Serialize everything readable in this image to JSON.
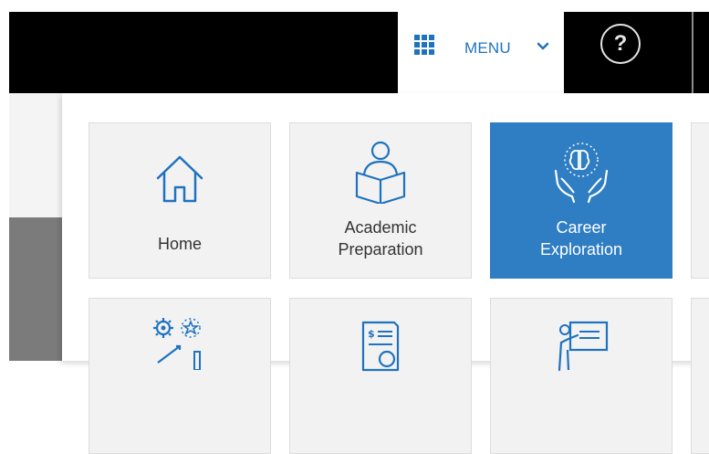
{
  "header": {
    "menu_label": "MENU",
    "help_label": "?",
    "icons": {
      "menu": "grid-icon",
      "chevron": "chevron-down-icon",
      "help": "question-circle-icon"
    }
  },
  "menu_tiles": [
    {
      "label": "Home",
      "icon": "house-icon",
      "active": false
    },
    {
      "label": "Academic\nPreparation",
      "icon": "reading-person-icon",
      "active": false
    },
    {
      "label": "Career\nExploration",
      "icon": "brain-hands-icon",
      "active": true
    },
    {
      "label": "",
      "icon": "gears-growth-icon",
      "active": false
    },
    {
      "label": "",
      "icon": "financial-document-icon",
      "active": false
    },
    {
      "label": "",
      "icon": "presentation-icon",
      "active": false
    }
  ],
  "colors": {
    "accent": "#2f7dc3",
    "icon_blue": "#1f72bf",
    "topbar": "#000000",
    "tile_bg": "#f2f2f2"
  }
}
